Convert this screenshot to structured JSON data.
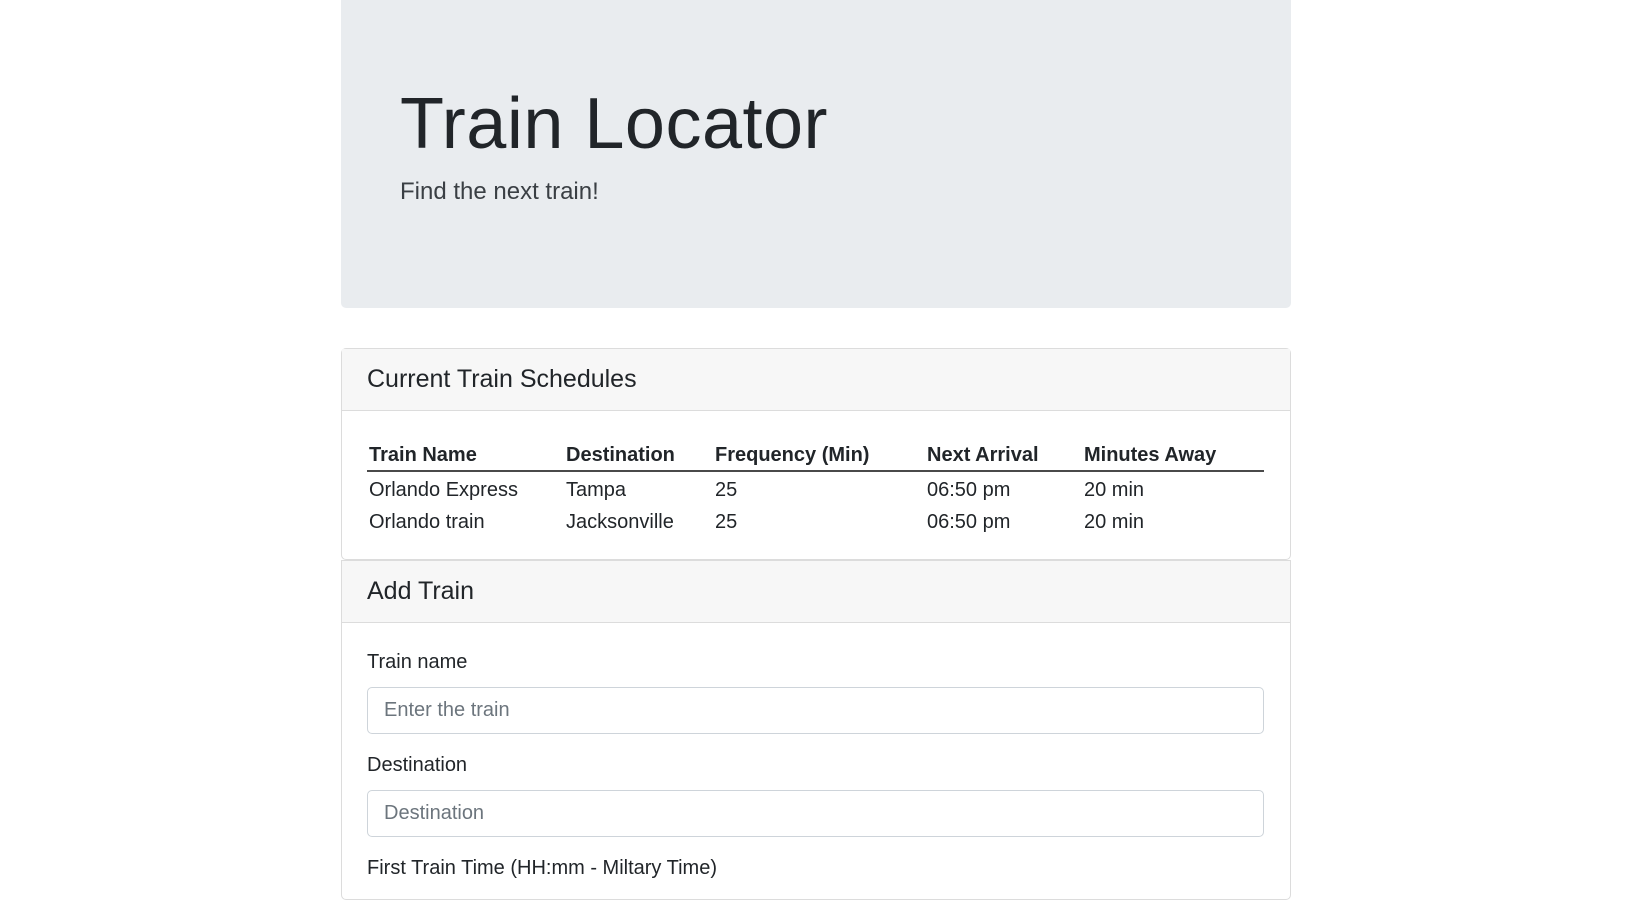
{
  "header": {
    "title": "Train Locator",
    "subtitle": "Find the next train!"
  },
  "schedules": {
    "title": "Current Train Schedules",
    "columns": [
      "Train Name",
      "Destination",
      "Frequency (Min)",
      "Next Arrival",
      "Minutes Away"
    ],
    "rows": [
      [
        "Orlando Express",
        "Tampa",
        "25",
        "06:50 pm",
        "20 min"
      ],
      [
        "Orlando train",
        "Jacksonville",
        "25",
        "06:50 pm",
        "20 min"
      ]
    ]
  },
  "add_train": {
    "title": "Add Train",
    "train_name_label": "Train name",
    "train_name_placeholder": "Enter the train",
    "destination_label": "Destination",
    "destination_placeholder": "Destination",
    "first_time_label": "First Train Time (HH:mm - Miltary Time)"
  }
}
